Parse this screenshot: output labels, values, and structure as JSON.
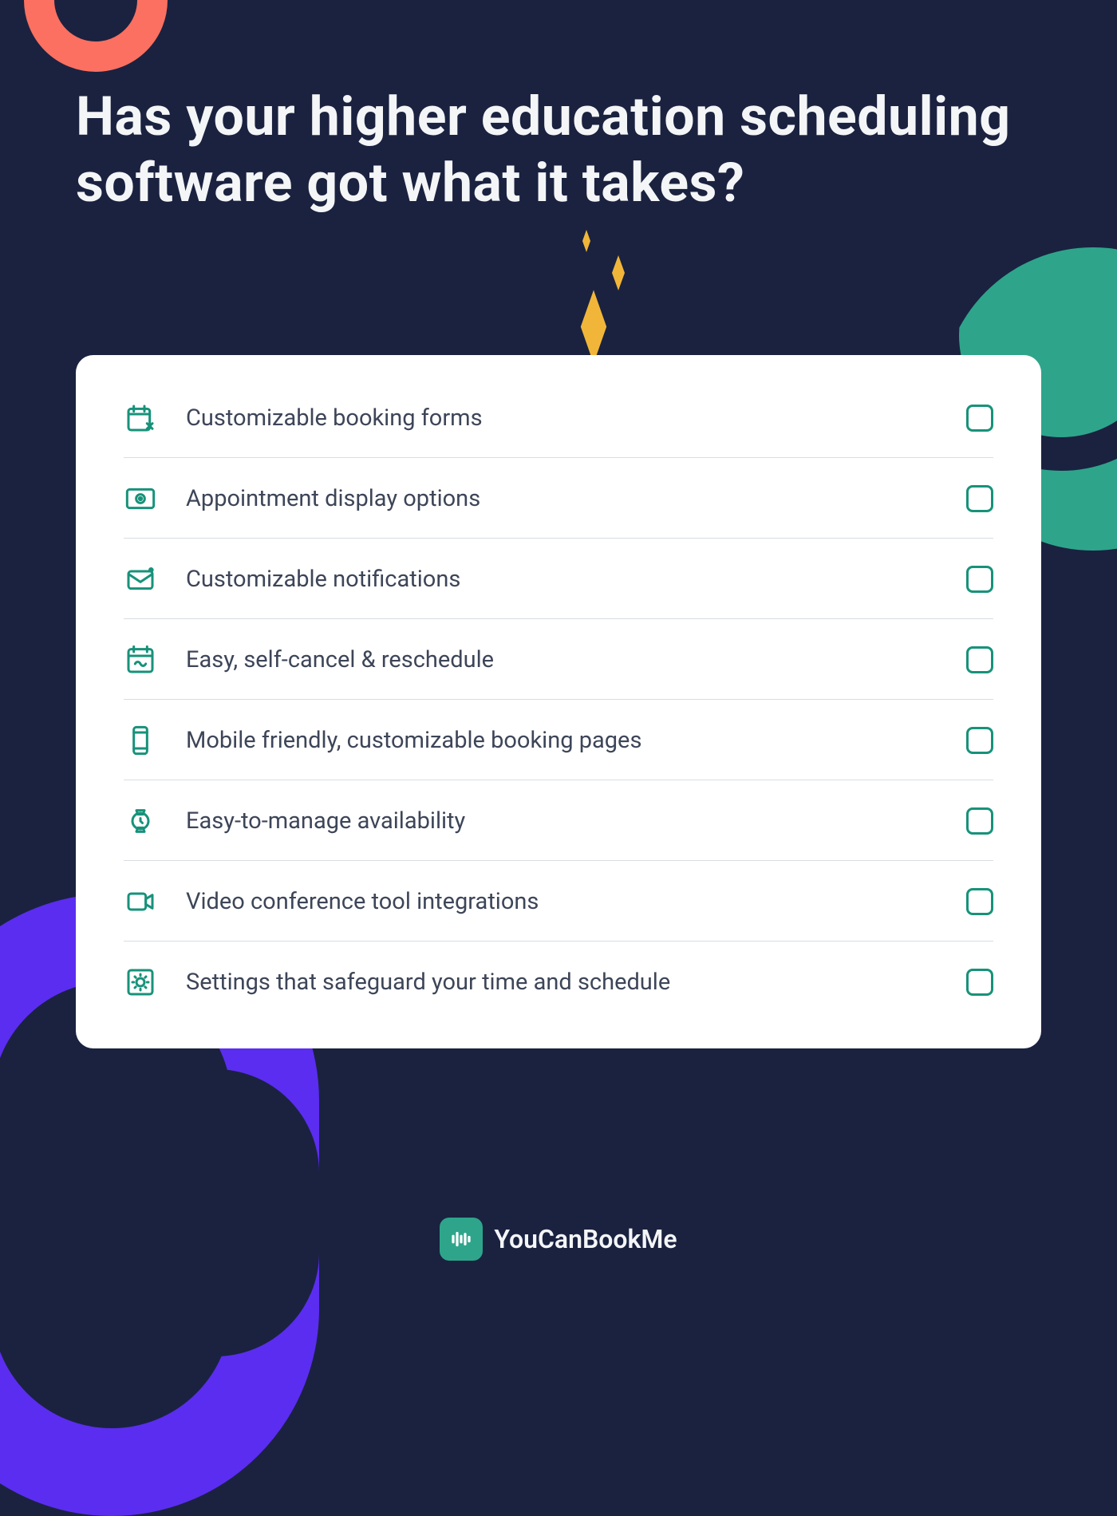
{
  "colors": {
    "background": "#1a2240",
    "accent_teal": "#17927a",
    "accent_teal_light": "#2ea58b",
    "accent_coral": "#fb7060",
    "accent_purple": "#5b2df0",
    "accent_gold": "#f1b639",
    "text_light": "#f4f5f7",
    "text_dark": "#3d4558",
    "card_bg": "#ffffff",
    "divider": "#d9dde2"
  },
  "heading": "Has your higher education scheduling software got what it takes?",
  "checklist": [
    {
      "icon": "calendar-edit-icon",
      "label": "Customizable booking forms",
      "checked": false
    },
    {
      "icon": "eye-icon",
      "label": "Appointment display options",
      "checked": false
    },
    {
      "icon": "mail-dot-icon",
      "label": "Customizable notifications",
      "checked": false
    },
    {
      "icon": "calendar-loop-icon",
      "label": "Easy, self-cancel & reschedule",
      "checked": false
    },
    {
      "icon": "mobile-icon",
      "label": "Mobile friendly, customizable booking pages",
      "checked": false
    },
    {
      "icon": "watch-icon",
      "label": "Easy-to-manage availability",
      "checked": false
    },
    {
      "icon": "video-icon",
      "label": "Video conference tool integrations",
      "checked": false
    },
    {
      "icon": "settings-gear-icon",
      "label": "Settings that safeguard your time and schedule",
      "checked": false
    }
  ],
  "footer": {
    "brand": "YouCanBookMe",
    "logo_icon": "bars-logo-icon"
  }
}
